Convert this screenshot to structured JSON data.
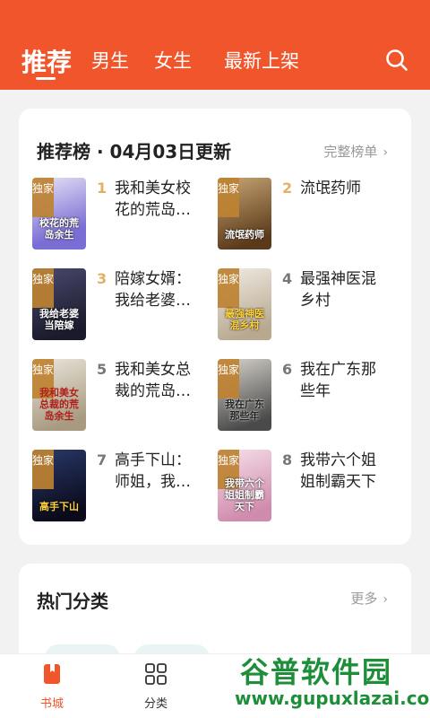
{
  "header": {
    "tabs": [
      {
        "label": "推荐",
        "active": true
      },
      {
        "label": "男生",
        "active": false
      },
      {
        "label": "女生",
        "active": false
      },
      {
        "label": "最新上架",
        "active": false
      }
    ],
    "background_color": "#f0552b"
  },
  "ranking": {
    "title": "推荐榜 · 04月03日更新",
    "more_label": "完整榜单",
    "books": [
      {
        "rank": "1",
        "title": "我和美女校花的荒岛…",
        "badge": "独家",
        "cover_text": "校花的荒岛余生",
        "cover_color": "#7a6ed4"
      },
      {
        "rank": "2",
        "title": "流氓药师",
        "badge": "独家",
        "cover_text": "流氓药师",
        "cover_color": "#8a5a2a"
      },
      {
        "rank": "3",
        "title": "陪嫁女婿：我给老婆…",
        "badge": "独家",
        "cover_text": "我给老婆当陪嫁",
        "cover_color": "#2a2a4a"
      },
      {
        "rank": "4",
        "title": "最强神医混乡村",
        "badge": "独家",
        "cover_text": "最强神医混乡村",
        "cover_color": "#d0c8b8"
      },
      {
        "rank": "5",
        "title": "我和美女总裁的荒岛…",
        "badge": "独家",
        "cover_text": "我和美女总裁的荒岛余生",
        "cover_color": "#c8bfb0"
      },
      {
        "rank": "6",
        "title": "我在广东那些年",
        "badge": "独家",
        "cover_text": "我在广东那些年",
        "cover_color": "#8a8a8a"
      },
      {
        "rank": "7",
        "title": "高手下山：师姐，我…",
        "badge": "独家",
        "cover_text": "高手下山",
        "cover_color": "#1a1a3a"
      },
      {
        "rank": "8",
        "title": "我带六个姐姐制霸天下",
        "badge": "独家",
        "cover_text": "我带六个姐姐制霸天下",
        "cover_color": "#e7b6c8"
      }
    ]
  },
  "categories": {
    "title": "热门分类",
    "more_label": "更多"
  },
  "tabbar": {
    "items": [
      {
        "label": "书城",
        "active": true
      },
      {
        "label": "分类",
        "active": false
      }
    ],
    "active_color": "#f0552b"
  },
  "watermark": {
    "cn": "谷普软件园",
    "en": "www.gupuxlazai.com"
  }
}
